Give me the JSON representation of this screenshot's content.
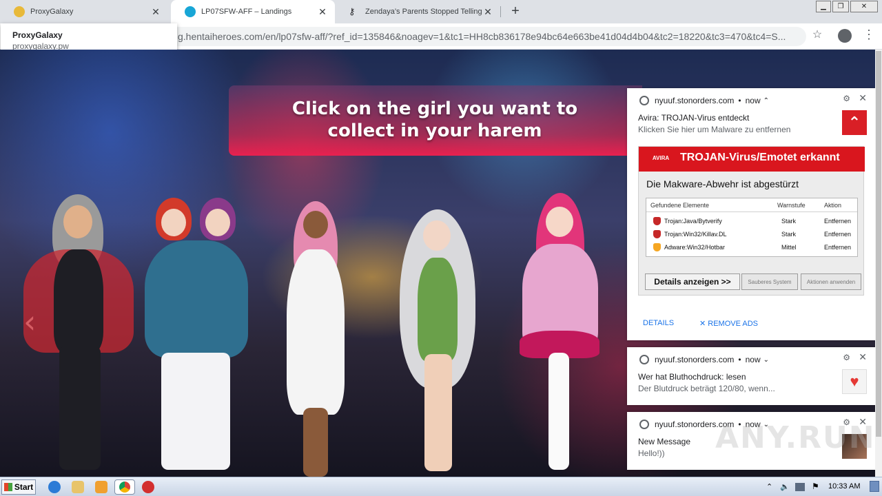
{
  "tabs": [
    {
      "title": "ProxyGalaxy",
      "icon": "proxygalaxy-favicon",
      "close": "✕"
    },
    {
      "title": "LP07SFW-AFF – Landings",
      "icon": "hentaiheroes-favicon",
      "close": "✕"
    },
    {
      "title": "Zendaya’s Parents Stopped Telling H",
      "icon": "key-favicon",
      "close": "✕"
    }
  ],
  "new_tab": "+",
  "window_buttons": {
    "minimize": "▁",
    "maximize": "❐",
    "close": "✕"
  },
  "omnibox": {
    "url": "g.hentaiheroes.com/en/lp07sfw-aff/?ref_id=135846&noagev=1&tc1=HH8cb836178e94bc64e663be41d04d4b04&tc2=18220&tc3=470&tc4=S..."
  },
  "hovercard": {
    "title": "ProxyGalaxy",
    "url": "proxygalaxy.pw"
  },
  "page": {
    "headline": "Click on the girl you want to collect in your harem",
    "prev_arrow": "‹"
  },
  "notifications": [
    {
      "origin": "nyuuf.stonorders.com",
      "time": "now",
      "chevron": "⌃",
      "title": "Avira: TROJAN-Virus entdeckt",
      "body": "Klicken Sie hier um Malware zu entfernen",
      "image": {
        "logo_text": "AVIRA",
        "header": "TROJAN-Virus/Emotet erkannt",
        "subtitle": "Die Makware-Abwehr ist abgestürzt",
        "columns": [
          "Gefundene Elemente",
          "Warnstufe",
          "Aktion"
        ],
        "rows": [
          {
            "name": "Trojan:Java/Bytverify",
            "level": "Stark",
            "action": "Entfernen",
            "color": "#c62828"
          },
          {
            "name": "Trojan:Win32/Killav.DL",
            "level": "Stark",
            "action": "Entfernen",
            "color": "#c62828"
          },
          {
            "name": "Adware:Win32/Hotbar",
            "level": "Mittel",
            "action": "Entfernen",
            "color": "#f5a623"
          }
        ],
        "buttons": [
          "Details anzeigen >>",
          "Sauberes System",
          "Aktionen anwenden"
        ]
      },
      "actions": [
        "DETAILS",
        "✕ REMOVE ADS"
      ]
    },
    {
      "origin": "nyuuf.stonorders.com",
      "time": "now",
      "chevron": "⌄",
      "title": "Wer hat Bluthochdruck: lesen",
      "body": "Der Blutdruck beträgt 120/80, wenn..."
    },
    {
      "origin": "nyuuf.stonorders.com",
      "time": "now",
      "chevron": "⌄",
      "title": "New Message",
      "body": "Hello!))"
    }
  ],
  "taskbar": {
    "start": "Start",
    "clock": "10:33 AM"
  },
  "watermark": "ANY.RUN",
  "colors": {
    "avira_red": "#d9161e",
    "banner_pink": "#e8214f",
    "link_blue": "#1a73e8"
  }
}
